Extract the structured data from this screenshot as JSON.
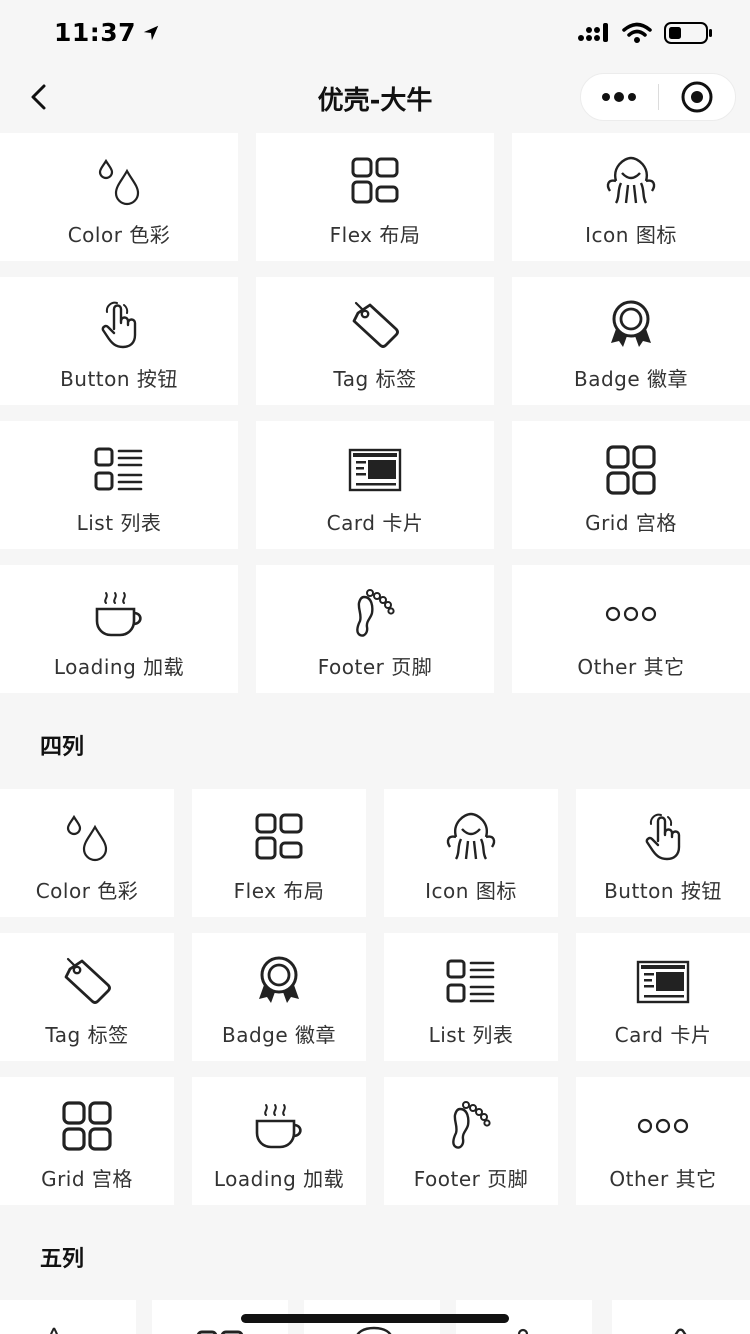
{
  "status_bar": {
    "time": "11:37"
  },
  "nav": {
    "title": "优壳-大牛"
  },
  "section_three": {
    "items": [
      {
        "label": "Color 色彩",
        "icon": "drops-icon"
      },
      {
        "label": "Flex 布局",
        "icon": "flex-layout-icon"
      },
      {
        "label": "Icon 图标",
        "icon": "octopus-icon"
      },
      {
        "label": "Button 按钮",
        "icon": "hand-pointer-icon"
      },
      {
        "label": "Tag 标签",
        "icon": "tag-icon"
      },
      {
        "label": "Badge 徽章",
        "icon": "badge-icon"
      },
      {
        "label": "List 列表",
        "icon": "list-icon"
      },
      {
        "label": "Card 卡片",
        "icon": "card-icon"
      },
      {
        "label": "Grid 宫格",
        "icon": "grid-icon"
      },
      {
        "label": "Loading 加载",
        "icon": "coffee-cup-icon"
      },
      {
        "label": "Footer 页脚",
        "icon": "footprint-icon"
      },
      {
        "label": "Other 其它",
        "icon": "three-circles-icon"
      }
    ]
  },
  "section_four": {
    "title": "四列",
    "items": [
      {
        "label": "Color 色彩",
        "icon": "drops-icon"
      },
      {
        "label": "Flex 布局",
        "icon": "flex-layout-icon"
      },
      {
        "label": "Icon 图标",
        "icon": "octopus-icon"
      },
      {
        "label": "Button 按钮",
        "icon": "hand-pointer-icon"
      },
      {
        "label": "Tag 标签",
        "icon": "tag-icon"
      },
      {
        "label": "Badge 徽章",
        "icon": "badge-icon"
      },
      {
        "label": "List 列表",
        "icon": "list-icon"
      },
      {
        "label": "Card 卡片",
        "icon": "card-icon"
      },
      {
        "label": "Grid 宫格",
        "icon": "grid-icon"
      },
      {
        "label": "Loading 加载",
        "icon": "coffee-cup-icon"
      },
      {
        "label": "Footer 页脚",
        "icon": "footprint-icon"
      },
      {
        "label": "Other 其它",
        "icon": "three-circles-icon"
      }
    ]
  },
  "section_five": {
    "title": "五列"
  }
}
